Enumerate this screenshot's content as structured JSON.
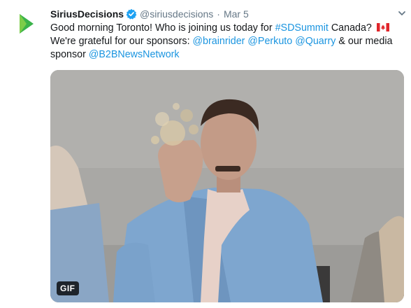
{
  "tweet": {
    "display_name": "SiriusDecisions",
    "handle": "@siriusdecisions",
    "separator": "·",
    "timestamp": "Mar 5",
    "text_1": "Good morning Toronto! Who is joining us today for ",
    "hashtag": "#SDSummit",
    "text_2": " Canada? ",
    "text_3": "We're grateful for our sponsors: ",
    "mention_1": "@brainrider",
    "mention_2": "@Perkuto",
    "mention_3": "@Quarry",
    "text_4": " & our media sponsor ",
    "mention_4": "@B2BNewsNetwork"
  },
  "media": {
    "badge": "GIF"
  },
  "icons": {
    "avatar": "siriusdecisions-logo-icon",
    "verified": "verified-badge-icon",
    "menu": "chevron-down-icon",
    "flag": "canada-flag-icon"
  },
  "colors": {
    "link": "#1b95e0",
    "verified": "#1da1f2",
    "muted": "#657786",
    "logo_green": "#3ab34a"
  }
}
